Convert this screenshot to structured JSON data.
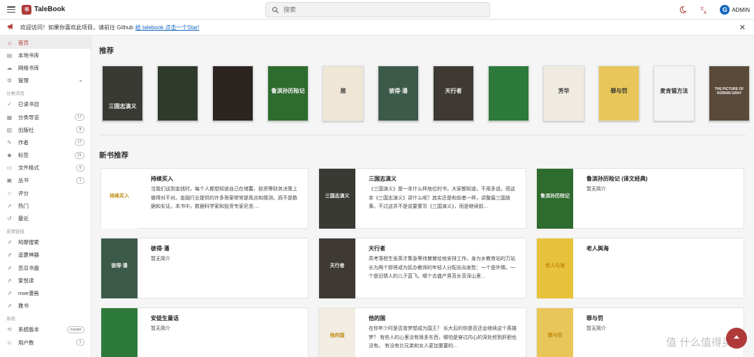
{
  "app": {
    "name": "TaleBook",
    "logo_char": "书"
  },
  "search": {
    "placeholder": "搜索"
  },
  "user": {
    "avatar_letter": "G",
    "name": "ADMIN"
  },
  "notice": {
    "text": "欢迎访问！如果你喜欢此项目，请前往 Github",
    "link_text": "给 talebook 点击一个Star!"
  },
  "sidebar": {
    "items_top": [
      {
        "label": "首页",
        "icon": "home-icon",
        "active": true
      },
      {
        "label": "本地书库",
        "icon": "library-icon"
      },
      {
        "label": "网络书库",
        "icon": "cloud-icon"
      },
      {
        "label": "管理",
        "icon": "gear-icon",
        "caret": "⌄"
      }
    ],
    "section_browse": "分类浏览",
    "items_browse": [
      {
        "label": "已读书目",
        "icon": "check-icon"
      },
      {
        "label": "分类导览",
        "icon": "grid-icon",
        "count": "17"
      },
      {
        "label": "出版社",
        "icon": "publisher-icon",
        "count": "8"
      },
      {
        "label": "作者",
        "icon": "author-icon",
        "count": "17"
      },
      {
        "label": "标签",
        "icon": "tag-icon",
        "count": "21"
      },
      {
        "label": "文件格式",
        "icon": "file-icon",
        "count": "6"
      },
      {
        "label": "丛书",
        "icon": "series-icon",
        "count": "1"
      },
      {
        "label": "评分",
        "icon": "star-icon"
      },
      {
        "label": "热门",
        "icon": "trend-icon"
      },
      {
        "label": "最近",
        "icon": "history-icon"
      }
    ],
    "section_links": "友情链接",
    "items_links": [
      {
        "label": "鸠摩搜索",
        "icon": "link-icon"
      },
      {
        "label": "追更神器",
        "icon": "link-icon"
      },
      {
        "label": "苦瓜书盘",
        "icon": "link-icon"
      },
      {
        "label": "爱悦读",
        "icon": "link-icon"
      },
      {
        "label": "moe漫画",
        "icon": "link-icon"
      },
      {
        "label": "雅书",
        "icon": "link-icon"
      }
    ],
    "section_system": "系统",
    "items_system": [
      {
        "label": "系统版本",
        "icon": "version-icon",
        "count": "master"
      },
      {
        "label": "用户数",
        "icon": "users-icon",
        "count": "1"
      }
    ]
  },
  "main": {
    "recommend_title": "推荐",
    "covers": [
      {
        "text": "三国志演义",
        "bg": "#3a3a34"
      },
      {
        "text": "",
        "bg": "#2f3a2c"
      },
      {
        "text": "",
        "bg": "#2b2420"
      },
      {
        "text": "鲁滨孙历险记",
        "bg": "#2e6b2e"
      },
      {
        "text": "居",
        "bg": "#efe6d6"
      },
      {
        "text": "彼得·潘",
        "bg": "#3c5a4a"
      },
      {
        "text": "天行者",
        "bg": "#3e3a33"
      },
      {
        "text": "",
        "bg": "#2d7a3c"
      },
      {
        "text": "芳华",
        "bg": "#efebe0"
      },
      {
        "text": "罪与罚",
        "bg": "#e8c65a"
      },
      {
        "text": "麦肯锡方法",
        "bg": "#f3f3f3"
      },
      {
        "text": "THE PICTURE OF DORIAN GRAY",
        "bg": "#5a4a3a"
      }
    ],
    "new_title": "新书推荐",
    "cards": [
      {
        "title": "持续买入",
        "desc": "当我们谈到金钱时，每个人都想知道自己在储蓄、投资等财务决策上做得对不对。金融行业提供的许多答案常常是观点和猜测，而不是数据和实证。本书中，数据科学家和投资专家尼克·...",
        "thumb_bg": "#fff",
        "thumb_text": "持续买入"
      },
      {
        "title": "三国志演义",
        "desc": "《三国演义》是一本什么样地位的书，大家都知道，不用多说。而这本《三国志演义》讲什么呢？其实还是和前者一样，讲整篇三国故事。不过这并不是说要重写《三国演义》，而是继续前...",
        "thumb_bg": "#3a3a34",
        "thumb_text": "三国志演义"
      },
      {
        "title": "鲁滨孙历险记 (译文经典)",
        "desc": "暂无简介",
        "thumb_bg": "#2e6b2e",
        "thumb_text": "鲁滨孙历险记"
      },
      {
        "title": "彼得·潘",
        "desc": "暂无简介",
        "thumb_bg": "#3c5a4a",
        "thumb_text": "彼得·潘"
      },
      {
        "title": "天行者",
        "desc": "高考落榜生张英才集急等待舅舅给他安排工作。身为乡教育站的万站长为两个即将成为民办教师的年轻人分配去向发愁：一个是外甥，一个是旧情人的儿子蓝飞。哪个去盛产男苔女苔深山里...",
        "thumb_bg": "#3e3a33",
        "thumb_text": "天行者"
      },
      {
        "title": "老人與海",
        "desc": "",
        "thumb_bg": "#e8c23a",
        "thumb_text": "老人与海"
      },
      {
        "title": "安徒生童话",
        "desc": "暂无简介",
        "thumb_bg": "#2d7a3c",
        "thumb_text": ""
      },
      {
        "title": "他的国",
        "desc": "在你年少时是否曾梦想成为国王？ 长大后的你是否还会继续这个英雄梦？ 有些人的心里没有很多东西，哪怕是穿过内心的深处挖到肝胆也没有。 有没有比兄弟和女人更加重要的...",
        "thumb_bg": "#f2ede2",
        "thumb_text": "他的国"
      },
      {
        "title": "罪与罚",
        "desc": "暂无简介",
        "thumb_bg": "#e8c65a",
        "thumb_text": "罪与罚"
      }
    ]
  },
  "watermark": "值 什么值得买",
  "colors": {
    "accent": "#b03a3a",
    "link": "#1565c0"
  }
}
